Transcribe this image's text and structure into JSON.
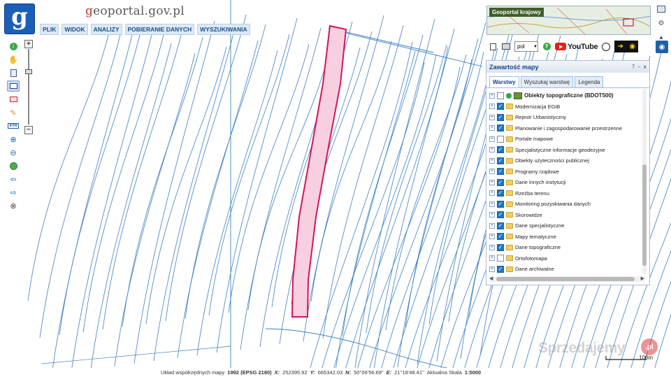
{
  "app": {
    "logo_letter": "g",
    "site_title_prefix": "g",
    "site_title_rest": "eoportal.gov.pl"
  },
  "menu": [
    "PLIK",
    "WIDOK",
    "ANALIZY",
    "POBIERANIE DANYCH",
    "WYSZUKIWANIA"
  ],
  "overview": {
    "title": "Geoportal krajowy"
  },
  "toolbar": {
    "language": "pol",
    "youtube_label": "YouTube"
  },
  "panel": {
    "title": "Zawartość mapy",
    "controls": [
      "?",
      "–",
      "x"
    ],
    "tabs": [
      {
        "label": "Warstwy",
        "active": true
      },
      {
        "label": "Wyszukaj warstwę",
        "active": false
      },
      {
        "label": "Legenda",
        "active": false
      }
    ],
    "top_layer": {
      "label": "Obiekty topograficzne (BDOT500)",
      "checked": false
    },
    "layers": [
      {
        "label": "Modernizacja EGiB",
        "checked": true
      },
      {
        "label": "Rejestr Urbanistyczny",
        "checked": true
      },
      {
        "label": "Planowanie i zagospodarowanie przestrzenne",
        "checked": true
      },
      {
        "label": "Portale mapowe",
        "checked": false
      },
      {
        "label": "Specjalistyczne informacje geodezyjne",
        "checked": true
      },
      {
        "label": "Obiekty użyteczności publicznej",
        "checked": true
      },
      {
        "label": "Programy rządowe",
        "checked": true
      },
      {
        "label": "Dane innych instytucji",
        "checked": true
      },
      {
        "label": "Rzeźba terenu",
        "checked": true
      },
      {
        "label": "Monitoring pozyskiwania danych",
        "checked": true
      },
      {
        "label": "Skorowidze",
        "checked": true
      },
      {
        "label": "Dane specjalistyczne",
        "checked": true
      },
      {
        "label": "Mapy tematyczne",
        "checked": true
      },
      {
        "label": "Dane topograficzne",
        "checked": true
      },
      {
        "label": "Ortofotomapa",
        "checked": false
      },
      {
        "label": "Dane archiwalne",
        "checked": true
      }
    ]
  },
  "status": {
    "system_label": "Układ współrzędnych mapy",
    "system_value": "1992 (EPSG 2180)",
    "x_label": "X:",
    "x_value": "252395.92",
    "y_label": "Y:",
    "y_value": "665342.03",
    "n_label": "N:",
    "n_value": "50°06'56.69\"",
    "e_label": "E:",
    "e_value": "21°18'48.41\"",
    "scale_label": "Aktualna Skala",
    "scale_value": "1:5000"
  },
  "scale_bar": "100m",
  "watermark": "Sprzedajemy",
  "watermark_badge": ".pl",
  "colors": {
    "parcel_line": "#3b7fc4",
    "highlight_fill": "#f7cfe0",
    "highlight_stroke": "#d4145a",
    "brand_blue": "#1c5fb8"
  }
}
